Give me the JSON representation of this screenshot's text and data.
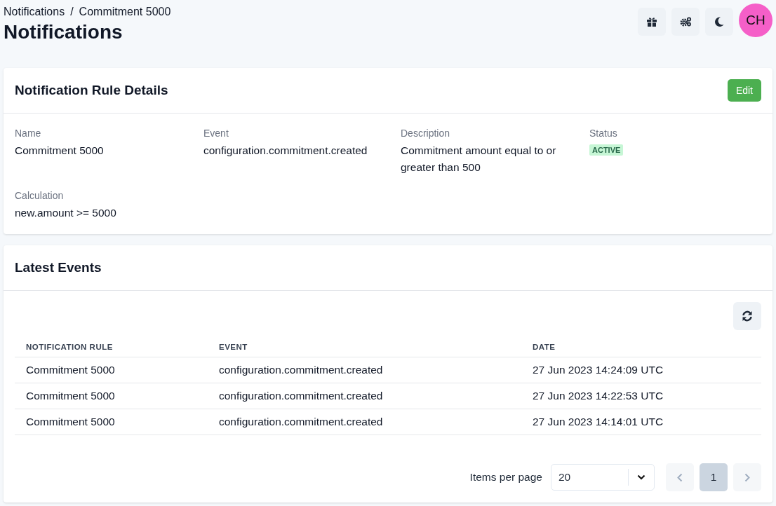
{
  "breadcrumb": [
    "Notifications",
    "Commitment 5000"
  ],
  "breadcrumb_separator": "/",
  "title": "Notifications",
  "avatar": {
    "initials": "CH"
  },
  "rule_card": {
    "title": "Notification Rule Details",
    "edit_button": "Edit",
    "fields": [
      {
        "label": "Name",
        "value": "Commitment 5000",
        "kind": "text"
      },
      {
        "label": "Event",
        "value": "configuration.commitment.created",
        "kind": "text"
      },
      {
        "label": "Description",
        "value": "Commitment amount equal to or greater than 500",
        "kind": "text"
      },
      {
        "label": "Status",
        "value": "ACTIVE",
        "kind": "badge"
      },
      {
        "label": "Calculation",
        "value": "new.amount >= 5000",
        "kind": "text"
      }
    ]
  },
  "events_card": {
    "title": "Latest Events",
    "table": {
      "columns": [
        "NOTIFICATION RULE",
        "EVENT",
        "DATE"
      ],
      "rows": [
        [
          "Commitment 5000",
          "configuration.commitment.created",
          "27 Jun 2023 14:24:09 UTC"
        ],
        [
          "Commitment 5000",
          "configuration.commitment.created",
          "27 Jun 2023 14:22:53 UTC"
        ],
        [
          "Commitment 5000",
          "configuration.commitment.created",
          "27 Jun 2023 14:14:01 UTC"
        ]
      ]
    },
    "pagination": {
      "items_per_page_label": "Items per page",
      "items_per_page": "20",
      "prev_disabled": true,
      "next_disabled": true,
      "pages": [
        {
          "label": "1",
          "selected": true
        }
      ]
    }
  }
}
